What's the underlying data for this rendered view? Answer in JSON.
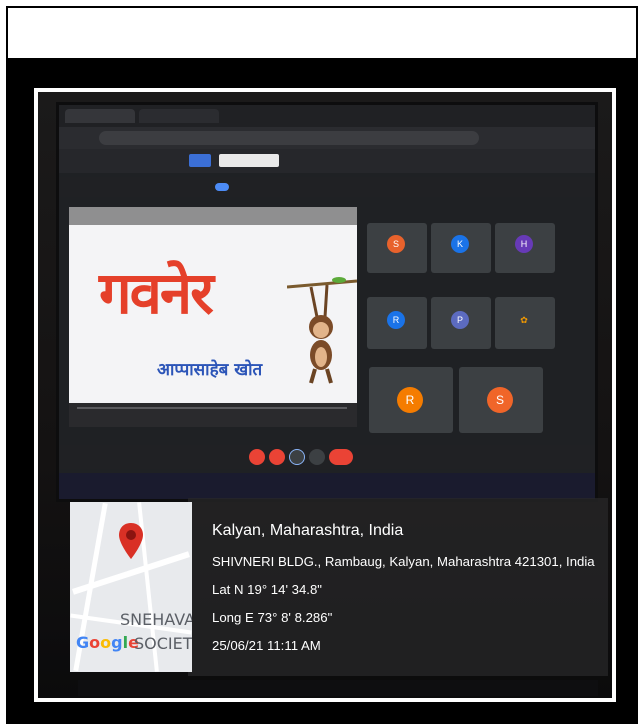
{
  "slide": {
    "title": "गवनेर",
    "subtitle": "आप्पासाहेब खोत"
  },
  "participants": [
    {
      "initial": "S",
      "color": "#e8622c"
    },
    {
      "initial": "K",
      "color": "#1a73e8"
    },
    {
      "initial": "H",
      "color": "#673ab7"
    },
    {
      "initial": "R",
      "color": "#1a73e8"
    },
    {
      "initial": "P",
      "color": "#5c6bc0"
    },
    {
      "initial": "",
      "color": "#f29900"
    },
    {
      "initial": "R",
      "color": "#f57c00"
    },
    {
      "initial": "S",
      "color": "#f06529"
    }
  ],
  "location": {
    "city_line": "Kalyan, Maharashtra, India",
    "address": "SHIVNERI BLDG., Rambaug, Kalyan, Maharashtra 421301, India",
    "lat": "Lat N 19° 14' 34.8\"",
    "long": "Long E 73° 8' 8.286\"",
    "datetime": "25/06/21 11:11 AM"
  },
  "map": {
    "place_top": "SNEHAVA",
    "brand": "Google",
    "place_bottom": "SOCIET",
    "pin_color": "#d93025",
    "brand_colors": [
      "#4285f4",
      "#ea4335",
      "#fbbc05",
      "#4285f4",
      "#34a853",
      "#ea4335"
    ]
  }
}
